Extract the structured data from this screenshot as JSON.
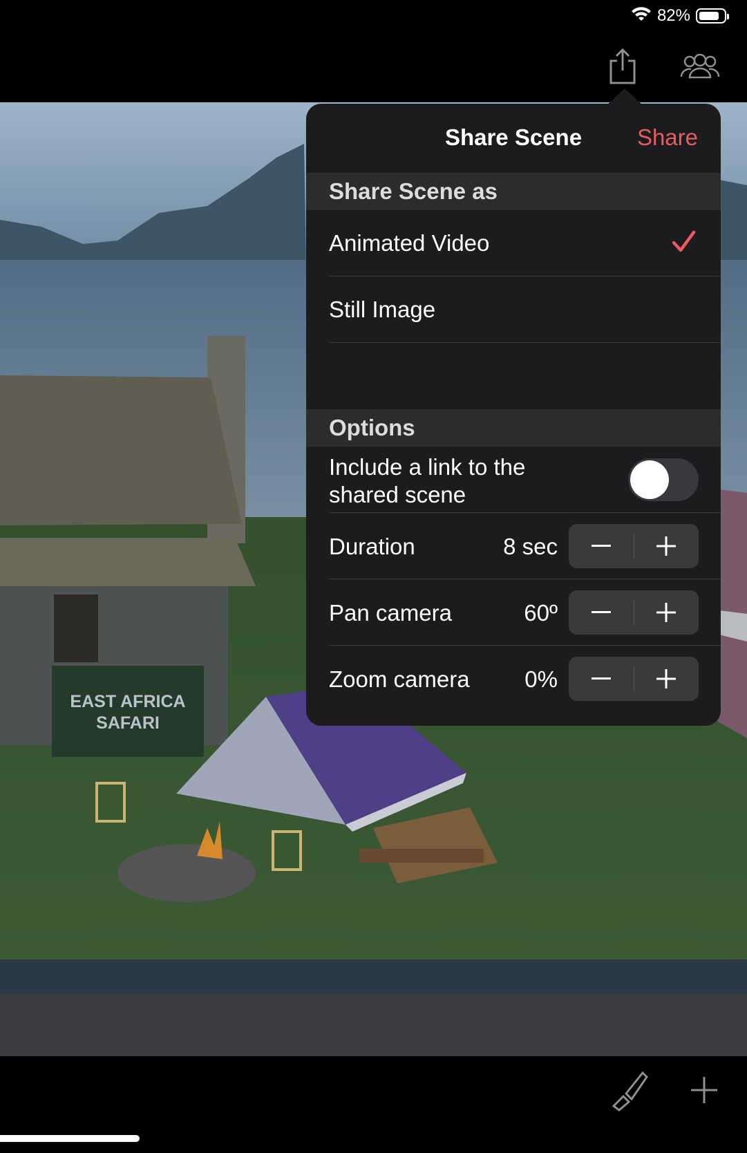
{
  "status_bar": {
    "battery_percent": "82%",
    "battery_level": 0.82,
    "icons": [
      "wifi-icon",
      "battery-icon"
    ]
  },
  "toolbar": {
    "icons": [
      "share-icon",
      "people-icon"
    ]
  },
  "bottom_toolbar": {
    "icons": [
      "paintbrush-icon",
      "plus-icon"
    ]
  },
  "scene": {
    "sign_line1": "EAST AFRICA",
    "sign_line2": "SAFARI"
  },
  "popover": {
    "title": "Share Scene",
    "share_label": "Share",
    "share_color": "#eb5a5f",
    "section_share_as": "Share Scene as",
    "options_share_as": [
      {
        "label": "Animated Video",
        "selected": true
      },
      {
        "label": "Still Image",
        "selected": false
      }
    ],
    "section_options": "Options",
    "link_toggle": {
      "label_line1": "Include a link to the",
      "label_line2": "shared scene",
      "on": false
    },
    "steppers": [
      {
        "label": "Duration",
        "value": "8 sec"
      },
      {
        "label": "Pan camera",
        "value": "60º"
      },
      {
        "label": "Zoom camera",
        "value": "0%"
      }
    ]
  }
}
